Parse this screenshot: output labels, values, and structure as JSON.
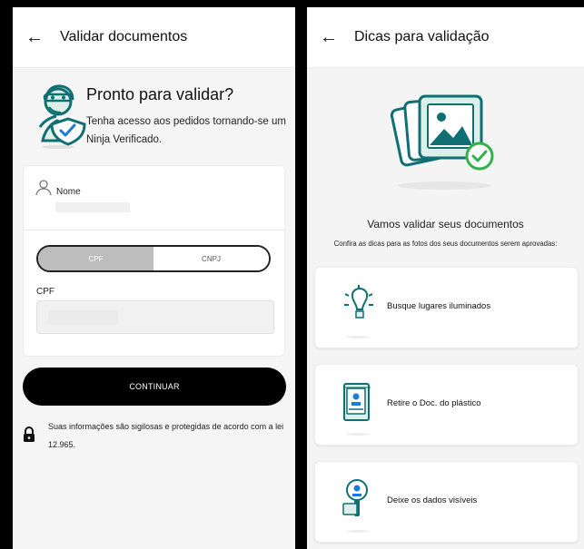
{
  "left_screen": {
    "header": {
      "back_icon": "arrow-left-icon",
      "title": "Validar documentos"
    },
    "intro": {
      "title": "Pronto para validar?",
      "text": "Tenha acesso aos pedidos tornando-se um Ninja Verificado."
    },
    "form": {
      "name_label": "Nome",
      "segmented": {
        "options": [
          "CPF",
          "CNPJ"
        ],
        "selected": "CPF"
      },
      "cpf_label": "CPF"
    },
    "continue_label": "CONTINUAR",
    "privacy_text": "Suas informações são sigilosas e protegidas de acordo com a lei 12.965."
  },
  "right_screen": {
    "header": {
      "back_icon": "arrow-left-icon",
      "title": "Dicas para validação"
    },
    "title": "Vamos validar seus documentos",
    "subtitle": "Confira as dicas para as fotos dos seus documentos serem aprovadas:",
    "tips": [
      {
        "label": "Busque lugares iluminados",
        "icon": "lightbulb-icon"
      },
      {
        "label": "Retire o Doc. do plástico",
        "icon": "document-plastic-icon"
      },
      {
        "label": "Deixe os dados visíveis",
        "icon": "magnifier-document-icon"
      }
    ]
  },
  "colors": {
    "accent_teal": "#0f6f73",
    "success_green": "#31b34a",
    "button_black": "#000000"
  }
}
